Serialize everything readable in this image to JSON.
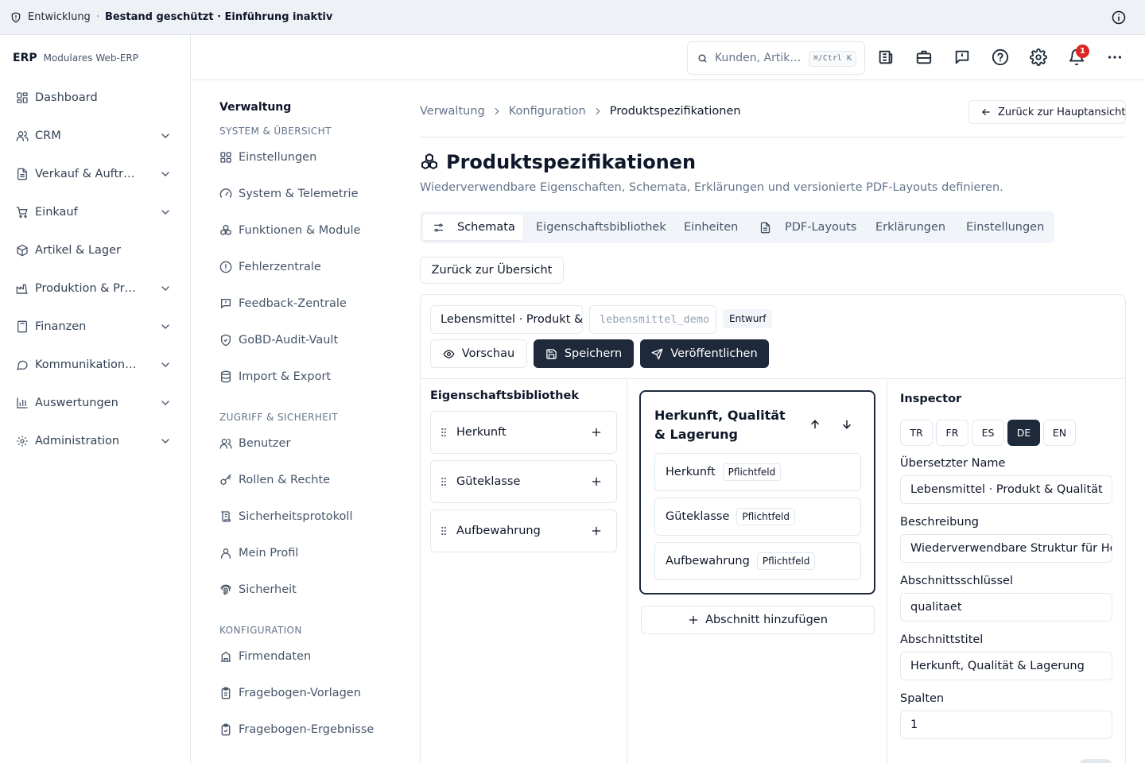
{
  "banner": {
    "environment": "Entwicklung",
    "separator": "·",
    "status": "Bestand geschützt · Einführung inaktiv"
  },
  "brand": {
    "name": "ERP",
    "tagline": "Modulares Web-ERP"
  },
  "sidebar": {
    "items": [
      {
        "label": "Dashboard",
        "icon": "dashboard-icon",
        "expandable": false
      },
      {
        "label": "CRM",
        "icon": "users-icon",
        "expandable": true
      },
      {
        "label": "Verkauf & Auftr…",
        "icon": "document-icon",
        "expandable": true
      },
      {
        "label": "Einkauf",
        "icon": "cart-icon",
        "expandable": true
      },
      {
        "label": "Artikel & Lager",
        "icon": "box-icon",
        "expandable": false
      },
      {
        "label": "Produktion & Pr…",
        "icon": "factory-icon",
        "expandable": true
      },
      {
        "label": "Finanzen",
        "icon": "calculator-icon",
        "expandable": true
      },
      {
        "label": "Kommunikation…",
        "icon": "chat-icon",
        "expandable": true
      },
      {
        "label": "Auswertungen",
        "icon": "bar-chart-icon",
        "expandable": true
      },
      {
        "label": "Administration",
        "icon": "gear-icon",
        "expandable": true
      }
    ]
  },
  "header": {
    "search_placeholder": "Kunden, Artik…",
    "search_shortcut": "⌘/Ctrl K",
    "notification_count": "1"
  },
  "subnav": {
    "title": "Verwaltung",
    "groups": [
      {
        "label": "SYSTEM & ÜBERSICHT"
      },
      {
        "label": "ZUGRIFF & SICHERHEIT"
      },
      {
        "label": "KONFIGURATION"
      }
    ],
    "links": [
      {
        "label": "Einstellungen"
      },
      {
        "label": "System & Telemetrie"
      },
      {
        "label": "Funktionen & Module"
      },
      {
        "label": "Fehlerzentrale"
      },
      {
        "label": "Feedback-Zentrale"
      },
      {
        "label": "GoBD-Audit-Vault"
      },
      {
        "label": "Import & Export"
      },
      {
        "label": "Benutzer"
      },
      {
        "label": "Rollen & Rechte"
      },
      {
        "label": "Sicherheitsprotokoll"
      },
      {
        "label": "Mein Profil"
      },
      {
        "label": "Sicherheit"
      },
      {
        "label": "Firmendaten"
      },
      {
        "label": "Fragebogen-Vorlagen"
      },
      {
        "label": "Fragebogen-Ergebnisse"
      }
    ]
  },
  "breadcrumb": [
    "Verwaltung",
    "Konfiguration",
    "Produktspezifikationen"
  ],
  "back_to_main": "Zurück zur Hauptansicht",
  "page": {
    "title": "Produktspezifikationen",
    "subtitle": "Wiederverwendbare Eigenschaften, Schemata, Erklärungen und versionierte PDF-Layouts definieren."
  },
  "tabs": [
    {
      "label": "Schemata",
      "active": true
    },
    {
      "label": "Eigenschaftsbibliothek",
      "active": false
    },
    {
      "label": "Einheiten",
      "active": false
    },
    {
      "label": "PDF-Layouts",
      "active": false
    },
    {
      "label": "Erklärungen",
      "active": false
    },
    {
      "label": "Einstellungen",
      "active": false
    }
  ],
  "back_to_overview": "Zurück zur Übersicht",
  "editor": {
    "name_value": "Lebensmittel · Produkt & Qualität",
    "slug_value": "lebensmittel_demo",
    "status_badge": "Entwurf",
    "preview_label": "Vorschau",
    "save_label": "Speichern",
    "publish_label": "Veröffentlichen"
  },
  "library": {
    "title": "Eigenschaftsbibliothek",
    "items": [
      {
        "label": "Herkunft"
      },
      {
        "label": "Güteklasse"
      },
      {
        "label": "Aufbewahrung"
      }
    ]
  },
  "section": {
    "title": "Herkunft, Qualität & Lagerung",
    "fields": [
      {
        "label": "Herkunft",
        "badge": "Pflichtfeld"
      },
      {
        "label": "Güteklasse",
        "badge": "Pflichtfeld"
      },
      {
        "label": "Aufbewahrung",
        "badge": "Pflichtfeld"
      }
    ],
    "add_label": "Abschnitt hinzufügen"
  },
  "inspector": {
    "title": "Inspector",
    "languages": [
      {
        "code": "TR",
        "active": false
      },
      {
        "code": "FR",
        "active": false
      },
      {
        "code": "ES",
        "active": false
      },
      {
        "code": "DE",
        "active": true
      },
      {
        "code": "EN",
        "active": false
      }
    ],
    "fields": [
      {
        "label": "Übersetzter Name",
        "value": "Lebensmittel · Produkt & Qualität"
      },
      {
        "label": "Beschreibung",
        "value": "Wiederverwendbare Struktur für Herkunft, Qualität und Lagerung"
      },
      {
        "label": "Abschnittsschlüssel",
        "value": "qualitaet"
      },
      {
        "label": "Abschnittstitel",
        "value": "Herkunft, Qualität & Lagerung"
      },
      {
        "label": "Spalten",
        "value": "1"
      }
    ]
  }
}
